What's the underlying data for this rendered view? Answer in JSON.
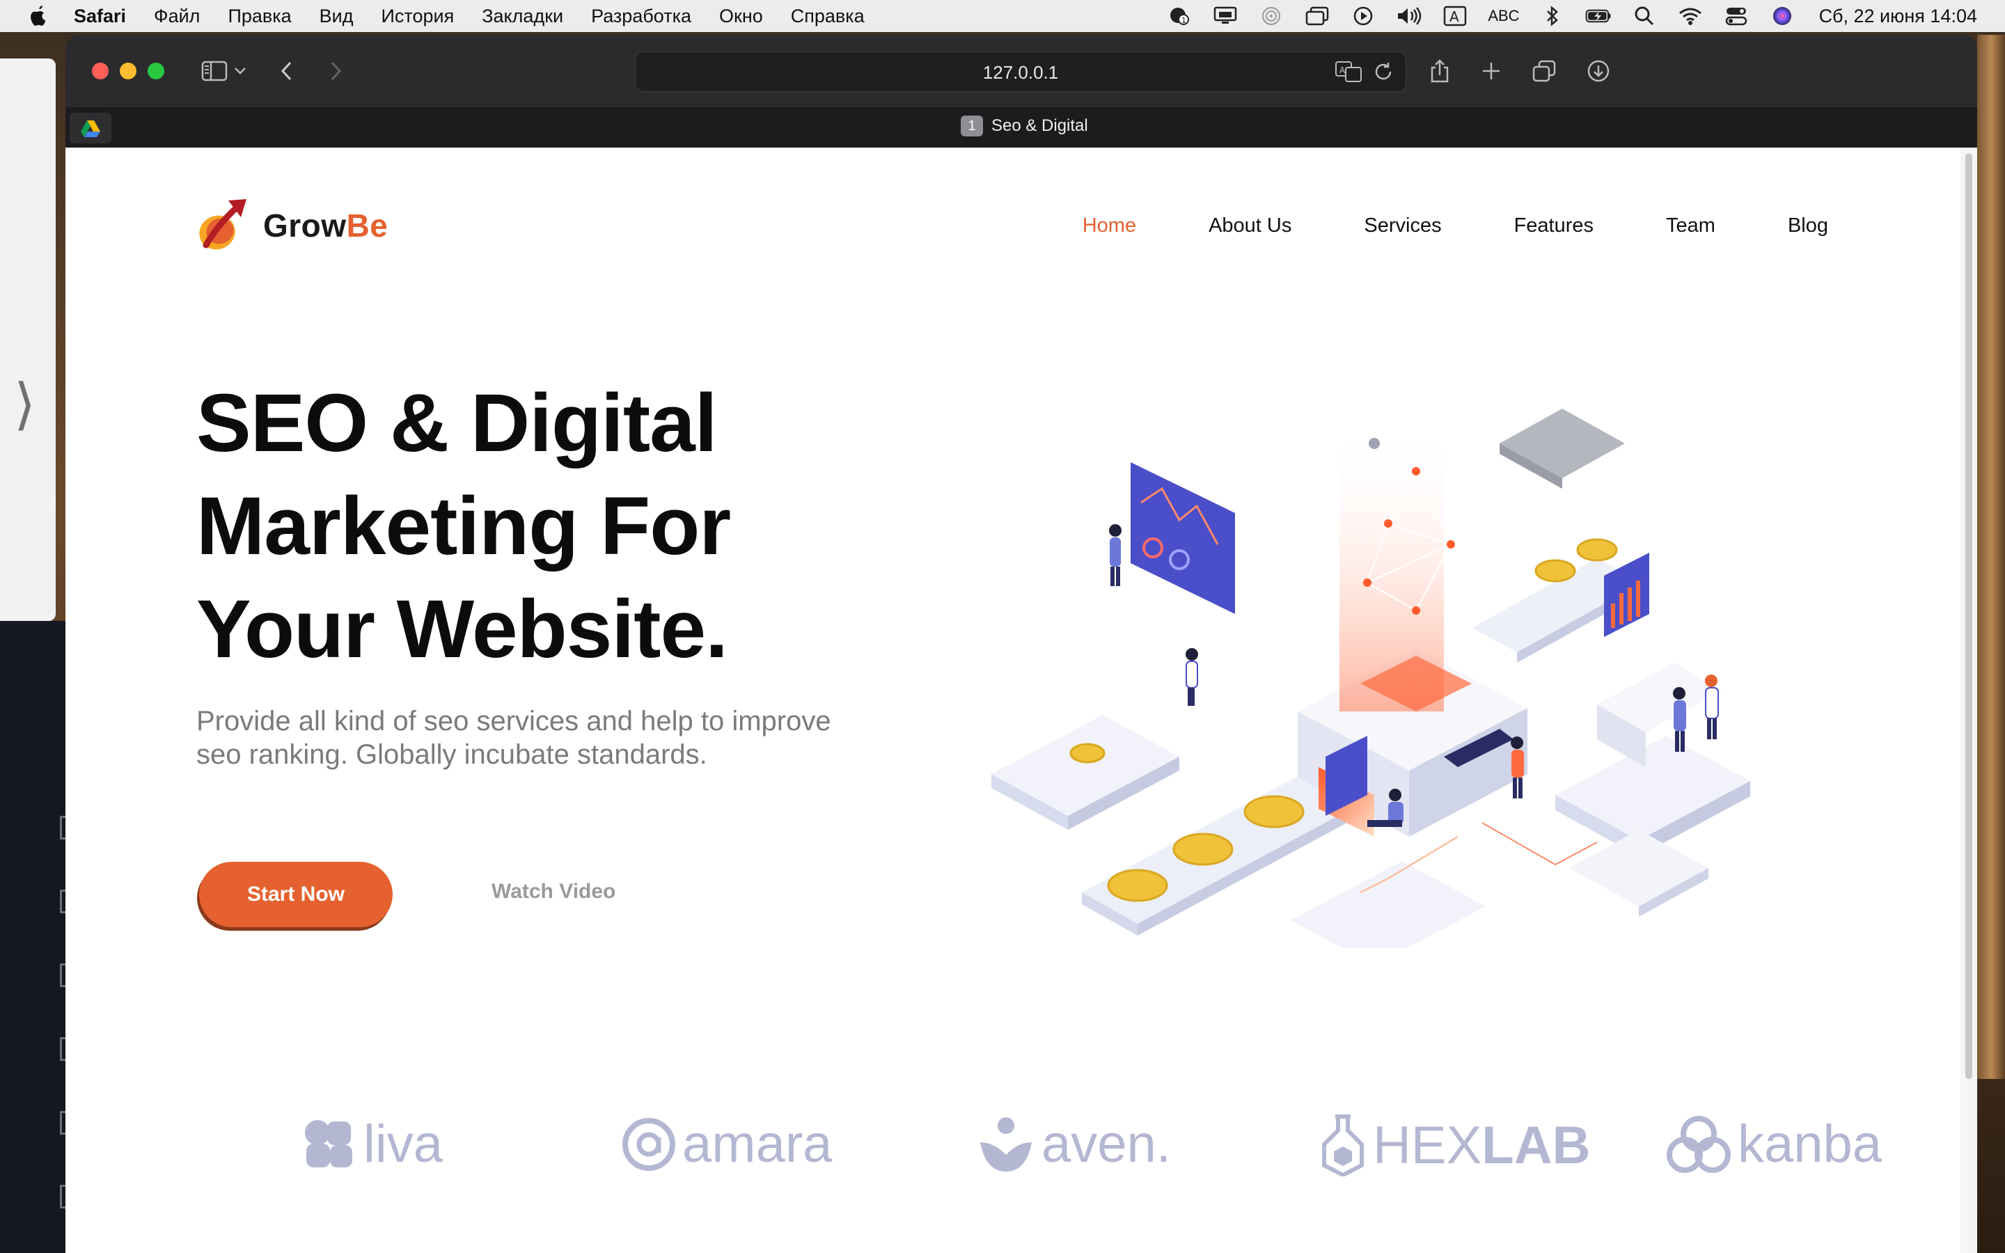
{
  "menubar": {
    "app": "Safari",
    "items": [
      "Файл",
      "Правка",
      "Вид",
      "История",
      "Закладки",
      "Разработка",
      "Окно",
      "Справка"
    ],
    "input_source": "ABC",
    "datetime": "Сб, 22 июня  14:04"
  },
  "browser": {
    "url": "127.0.0.1",
    "tab_index": "1",
    "tab_title": "Seo & Digital"
  },
  "site": {
    "logo_main": "Grow",
    "logo_accent": "Be",
    "nav": [
      "Home",
      "About Us",
      "Services",
      "Features",
      "Team",
      "Blog"
    ],
    "hero_title_lines": [
      "SEO & Digital",
      "Marketing For",
      "Your Website."
    ],
    "hero_subtitle": "Provide all kind of seo services and help to improve seo ranking. Globally incubate standards.",
    "start_label": "Start Now",
    "watch_label": "Watch Video",
    "brands": [
      "liva",
      "amara",
      "aven.",
      "HEX",
      "LAB",
      "kanba"
    ]
  },
  "colors": {
    "accent": "#e5612f",
    "brand_gray": "#b4b7d2",
    "chart_purple": "#4b4ec9"
  }
}
